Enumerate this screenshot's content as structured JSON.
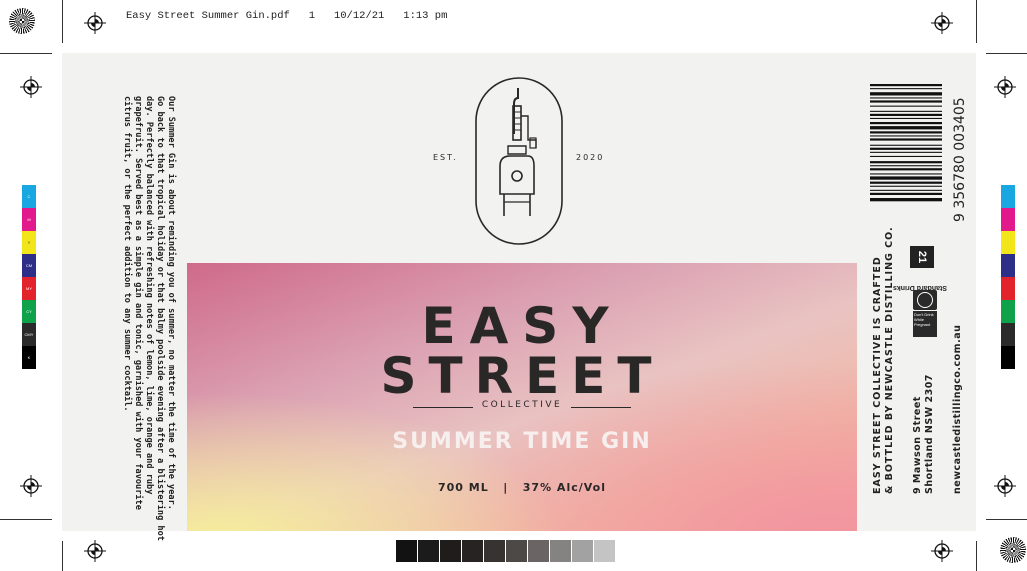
{
  "slug": {
    "filename": "Easy Street Summer Gin.pdf",
    "page": "1",
    "date": "10/12/21",
    "time": "1:13 pm"
  },
  "logo": {
    "est_label": "EST.",
    "year": "2020"
  },
  "brand": {
    "line1": "EASY",
    "line2": "STREET",
    "sub": "COLLECTIVE"
  },
  "product": {
    "name": "SUMMER TIME GIN",
    "volume": "700 ML",
    "separator": "|",
    "abv": "37% Alc/Vol"
  },
  "description": [
    "Our Summer Gin is about reminding you of summer, no matter the time of the year.",
    "Go back to that tropical holiday or that balmy poolside evening after a blistering hot",
    "day. Perfectly balanced with refreshing notes of lemon, lime, orange and ruby",
    "grapefruit. Served best as a simple gin and tonic, garnished with your favourite",
    "citrus fruit, or the perfect addition to any summer cocktail."
  ],
  "producer": {
    "line1": "EASY STREET COLLECTIVE IS CRAFTED",
    "line2": "& BOTTLED BY NEWCASTLE DISTILLING CO.",
    "address1": "9 Mawson Street",
    "address2": "Shortland NSW 2307",
    "website": "newcastledistillingco.com.au"
  },
  "standard_drinks": {
    "number": "21",
    "label": "Standard Drinks"
  },
  "pregnancy": {
    "label": "Don't Drink While Pregnant"
  },
  "barcode": {
    "digits": "9 356780 003405"
  },
  "color_bar": {
    "labels": [
      "C",
      "M",
      "Y",
      "CM",
      "MY",
      "CY",
      "CMY",
      "K"
    ],
    "colors": [
      "#18a7e0",
      "#e2188d",
      "#f2e51a",
      "#2d2e87",
      "#e3232b",
      "#10a24b",
      "#2a2a2a",
      "#000000"
    ]
  },
  "grey_ramp": [
    "#121212",
    "#1b1b1b",
    "#1f1d1c",
    "#262322",
    "#373331",
    "#4d4947",
    "#6a6564",
    "#858282",
    "#a3a2a2",
    "#c5c4c4"
  ]
}
